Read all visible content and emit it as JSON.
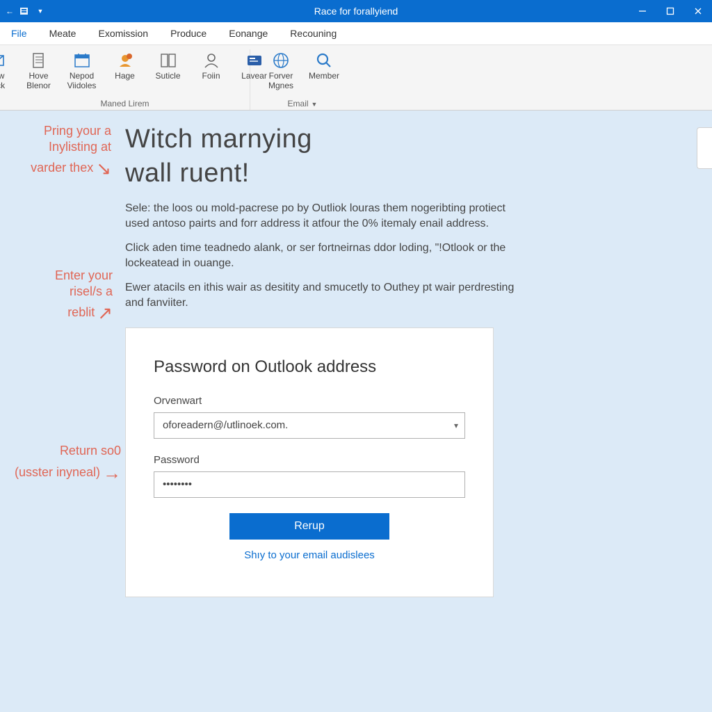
{
  "titlebar": {
    "app_title": "Race for forallyiend"
  },
  "menu": {
    "file": "File",
    "items": [
      "Meate",
      "Exomission",
      "Produce",
      "Eonange",
      "Recouning"
    ]
  },
  "ribbon": {
    "group1_label": "Maned Lirem",
    "group2_label": "Email",
    "buttons": [
      {
        "l1": "View",
        "l2": "Cock"
      },
      {
        "l1": "Hove",
        "l2": "Blenor"
      },
      {
        "l1": "Nepod",
        "l2": "Viidoles"
      },
      {
        "l1": "Hage",
        "l2": ""
      },
      {
        "l1": "Suticle",
        "l2": ""
      },
      {
        "l1": "Foiin",
        "l2": ""
      },
      {
        "l1": "Lavear",
        "l2": ""
      },
      {
        "l1": "Forver",
        "l2": "Mgnes"
      },
      {
        "l1": "Member",
        "l2": ""
      }
    ]
  },
  "annotations": {
    "a1": "Pring your a\nInylisting at\nvarder thex",
    "a2": "Enter your\nrisel/s a\nreblit",
    "a3": "Return so0\n(usster inyneal)"
  },
  "page": {
    "h1a": "Witch marnying",
    "h1b": "wall ruent!",
    "p1": "Sele: the loos ou mold-pacrese po by Outliok louras them nogeribting protiect used antoso pairts and forr address it atfour the 0% itemaly enail address.",
    "p2": "Click aden time teadnedo alank, or ser fortneirnas ddor loding, \"!Otlook or the lockeatead in ouange.",
    "p3": "Ewer atacils en ithis wair as desitity and smucetly to Outhey pt wair perdresting and fanviiter."
  },
  "login": {
    "title": "Password on Outlook address",
    "email_label": "Orvenwart",
    "email_value": "oforeadern@/utlinoek.com.",
    "password_label": "Password",
    "password_value": "••••••••",
    "submit": "Rerup",
    "link": "Shıy to your email audislees"
  }
}
